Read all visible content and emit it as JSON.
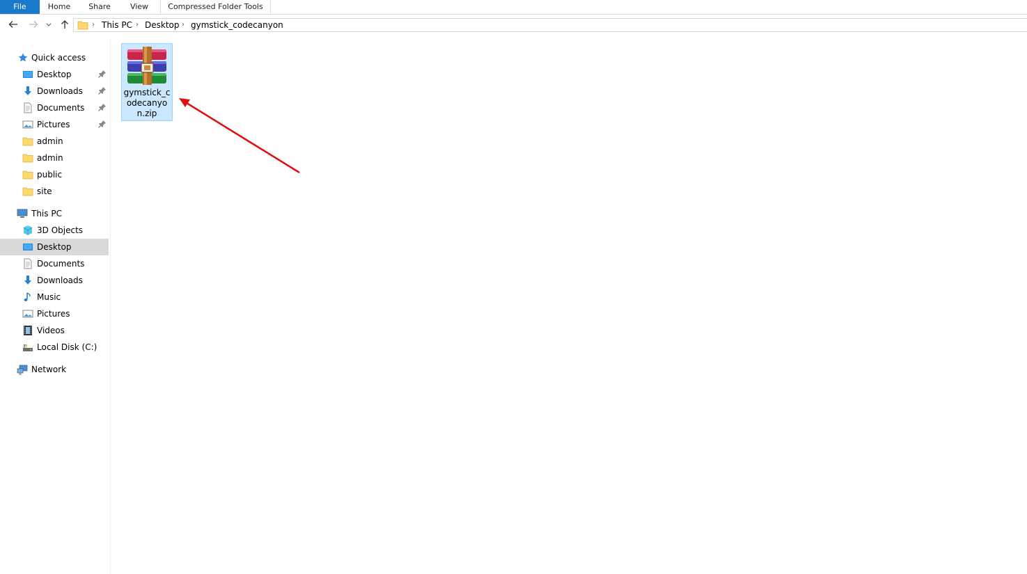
{
  "ribbon": {
    "tabs": [
      {
        "label": "File"
      },
      {
        "label": "Home"
      },
      {
        "label": "Share"
      },
      {
        "label": "View"
      },
      {
        "label": "Compressed Folder Tools"
      }
    ]
  },
  "address": {
    "crumbs": [
      "This PC",
      "Desktop",
      "gymstick_codecanyon"
    ]
  },
  "sidebar": {
    "quick_access": {
      "label": "Quick access",
      "items": [
        {
          "label": "Desktop",
          "icon": "desktop-icon",
          "pinned": true
        },
        {
          "label": "Downloads",
          "icon": "downloads-icon",
          "pinned": true
        },
        {
          "label": "Documents",
          "icon": "documents-icon",
          "pinned": true
        },
        {
          "label": "Pictures",
          "icon": "pictures-icon",
          "pinned": true
        },
        {
          "label": "admin",
          "icon": "folder-icon"
        },
        {
          "label": "admin",
          "icon": "folder-icon"
        },
        {
          "label": "public",
          "icon": "folder-icon"
        },
        {
          "label": "site",
          "icon": "folder-icon"
        }
      ]
    },
    "this_pc": {
      "label": "This PC",
      "items": [
        {
          "label": "3D Objects",
          "icon": "3d-objects-icon"
        },
        {
          "label": "Desktop",
          "icon": "desktop-icon",
          "selected": true
        },
        {
          "label": "Documents",
          "icon": "documents-icon"
        },
        {
          "label": "Downloads",
          "icon": "downloads-icon"
        },
        {
          "label": "Music",
          "icon": "music-icon"
        },
        {
          "label": "Pictures",
          "icon": "pictures-icon"
        },
        {
          "label": "Videos",
          "icon": "videos-icon"
        },
        {
          "label": "Local Disk (C:)",
          "icon": "local-disk-icon"
        }
      ]
    },
    "network": {
      "label": "Network"
    }
  },
  "content": {
    "files": [
      {
        "name": "gymstick_codecanyon.zip",
        "icon": "winrar-archive-icon",
        "selected": true
      }
    ]
  },
  "colors": {
    "accent": "#1979ca",
    "selection_fill": "#cce8ff",
    "annotation_arrow": "#e01010"
  }
}
